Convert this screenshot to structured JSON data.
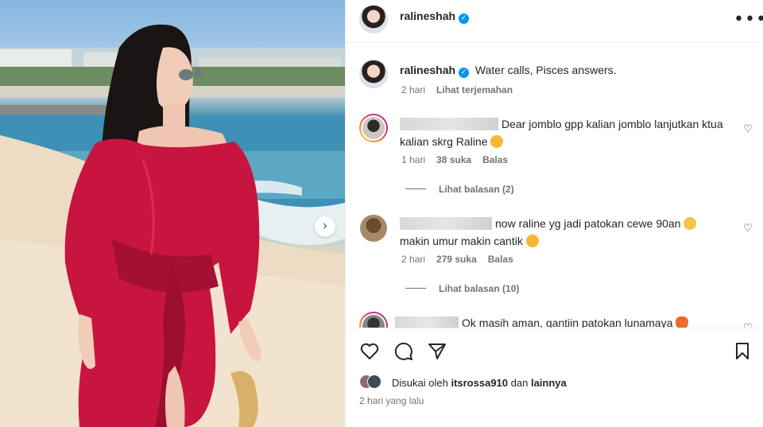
{
  "post": {
    "username": "ralineshah",
    "verified_icon": "verified-badge-icon",
    "more_icon": "more-options-icon",
    "caption": "Water calls, Pisces answers.",
    "caption_time": "2 hari",
    "translate_label": "Lihat terjemahan",
    "next_icon": "chevron-right-icon"
  },
  "comments": [
    {
      "text": "Dear jomblo gpp kalian jomblo lanjutkan ktua kalian skrg Raline",
      "time": "1 hari",
      "likes": "38 suka",
      "reply": "Balas",
      "view_replies": "Lihat balasan (2)"
    },
    {
      "text": "now raline yg jadi patokan cewe 90an",
      "text2": "makin umur makin cantik",
      "time": "2 hari",
      "likes": "279 suka",
      "reply": "Balas",
      "view_replies": "Lihat balasan (10)"
    },
    {
      "text": "Ok masih aman, gantiin patokan lunamaya"
    }
  ],
  "footer": {
    "liked_by_prefix": "Disukai oleh",
    "liked_by_user": "itsrossa910",
    "liked_by_and": "dan",
    "liked_by_others": "lainnya",
    "time": "2 hari yang lalu"
  },
  "colors": {
    "accent": "#0095f6",
    "dress": "#c8153f",
    "text": "#262626",
    "muted": "#737373"
  }
}
